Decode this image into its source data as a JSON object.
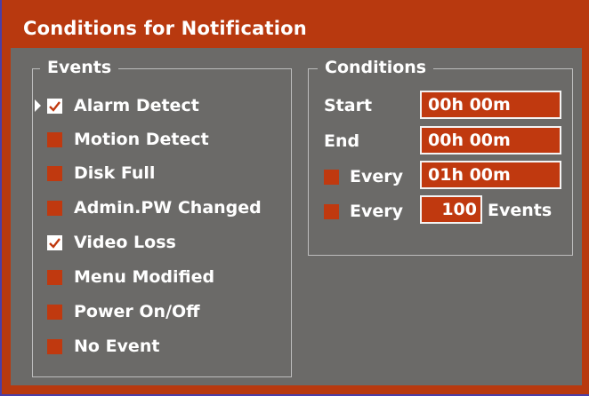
{
  "window": {
    "title": "Conditions for Notification"
  },
  "events": {
    "legend": "Events",
    "items": [
      {
        "label": "Alarm Detect",
        "checked": true,
        "selected": true
      },
      {
        "label": "Motion Detect",
        "checked": false
      },
      {
        "label": "Disk Full",
        "checked": false
      },
      {
        "label": "Admin.PW Changed",
        "checked": false
      },
      {
        "label": "Video Loss",
        "checked": true
      },
      {
        "label": "Menu Modified",
        "checked": false
      },
      {
        "label": "Power On/Off",
        "checked": false
      },
      {
        "label": "No Event",
        "checked": false
      }
    ]
  },
  "conditions": {
    "legend": "Conditions",
    "start": {
      "label": "Start",
      "value": "00h 00m"
    },
    "end": {
      "label": "End",
      "value": "00h 00m"
    },
    "every_time": {
      "label": "Every",
      "value": "01h 00m",
      "checked": false
    },
    "every_events": {
      "label": "Every",
      "value": "100",
      "suffix": "Events",
      "checked": false
    }
  },
  "colors": {
    "accent": "#b8390f",
    "panel": "#6b6a68",
    "field": "#c0390f",
    "text": "#ffffff"
  }
}
